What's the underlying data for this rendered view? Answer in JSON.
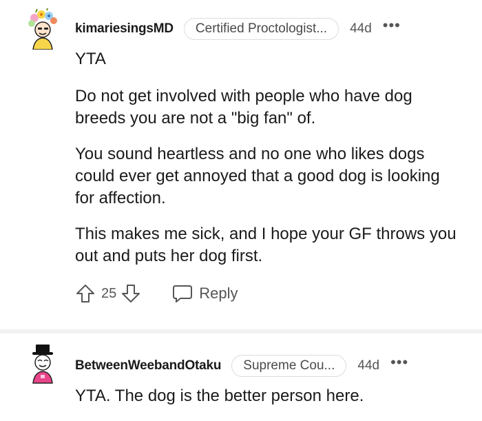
{
  "comments": [
    {
      "username": "kimariesingsMD",
      "flair": "Certified Proctologist...",
      "age": "44d",
      "more": "•••",
      "paragraphs": [
        "YTA",
        "Do not get involved with people who have dog breeds you are not a \"big fan\" of.",
        "You sound heartless and no one who likes dogs could ever get annoyed that a good dog is looking for affection.",
        "This makes me sick, and I hope your GF throws you out and puts her dog first."
      ],
      "score": "25",
      "reply_label": "Reply"
    },
    {
      "username": "BetweenWeebandOtaku",
      "flair": "Supreme Cou...",
      "age": "44d",
      "more": "•••",
      "paragraphs": [
        "YTA. The dog is the better person here."
      ]
    }
  ],
  "icons": {
    "upvote": "upvote-arrow-icon",
    "downvote": "downvote-arrow-icon",
    "reply": "speech-bubble-icon",
    "more": "more-options-icon"
  }
}
